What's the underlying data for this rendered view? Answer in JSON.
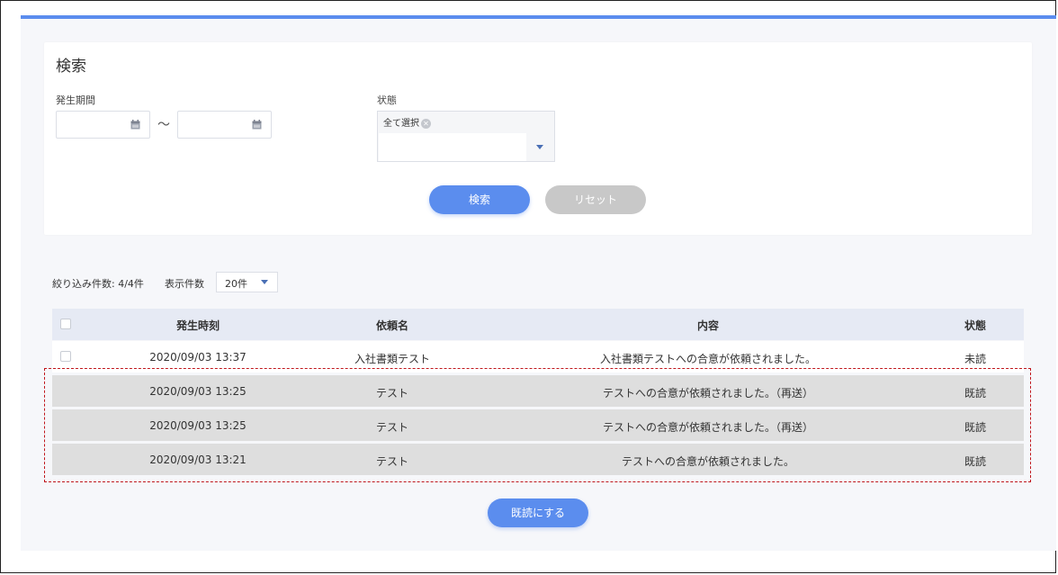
{
  "search": {
    "title": "検索",
    "period_label": "発生期間",
    "tilde": "～",
    "status_label": "状態",
    "status_chip": "全て選択",
    "chip_remove": "✕",
    "search_button": "検索",
    "reset_button": "リセット"
  },
  "list": {
    "count_label": "絞り込み件数: 4/4件",
    "display_label": "表示件数",
    "page_size": "20件",
    "headers": {
      "time": "発生時刻",
      "request": "依頼名",
      "content": "内容",
      "status": "状態"
    },
    "rows": [
      {
        "time": "2020/09/03 13:37",
        "request": "入社書類テスト",
        "content": "入社書類テストへの合意が依頼されました。",
        "status": "未読"
      },
      {
        "time": "2020/09/03 13:25",
        "request": "テスト",
        "content": "テストへの合意が依頼されました。（再送）",
        "status": "既読"
      },
      {
        "time": "2020/09/03 13:25",
        "request": "テスト",
        "content": "テストへの合意が依頼されました。（再送）",
        "status": "既読"
      },
      {
        "time": "2020/09/03 13:21",
        "request": "テスト",
        "content": "テストへの合意が依頼されました。",
        "status": "既読"
      }
    ],
    "mark_read_button": "既読にする"
  },
  "colors": {
    "accent": "#5b8dee",
    "reset": "#c8c8c8",
    "read_row": "#dedede",
    "header_bg": "#e6eaf4",
    "highlight": "#c0161b"
  },
  "icons": [
    "calendar-icon",
    "chevron-down-icon",
    "close-icon"
  ]
}
